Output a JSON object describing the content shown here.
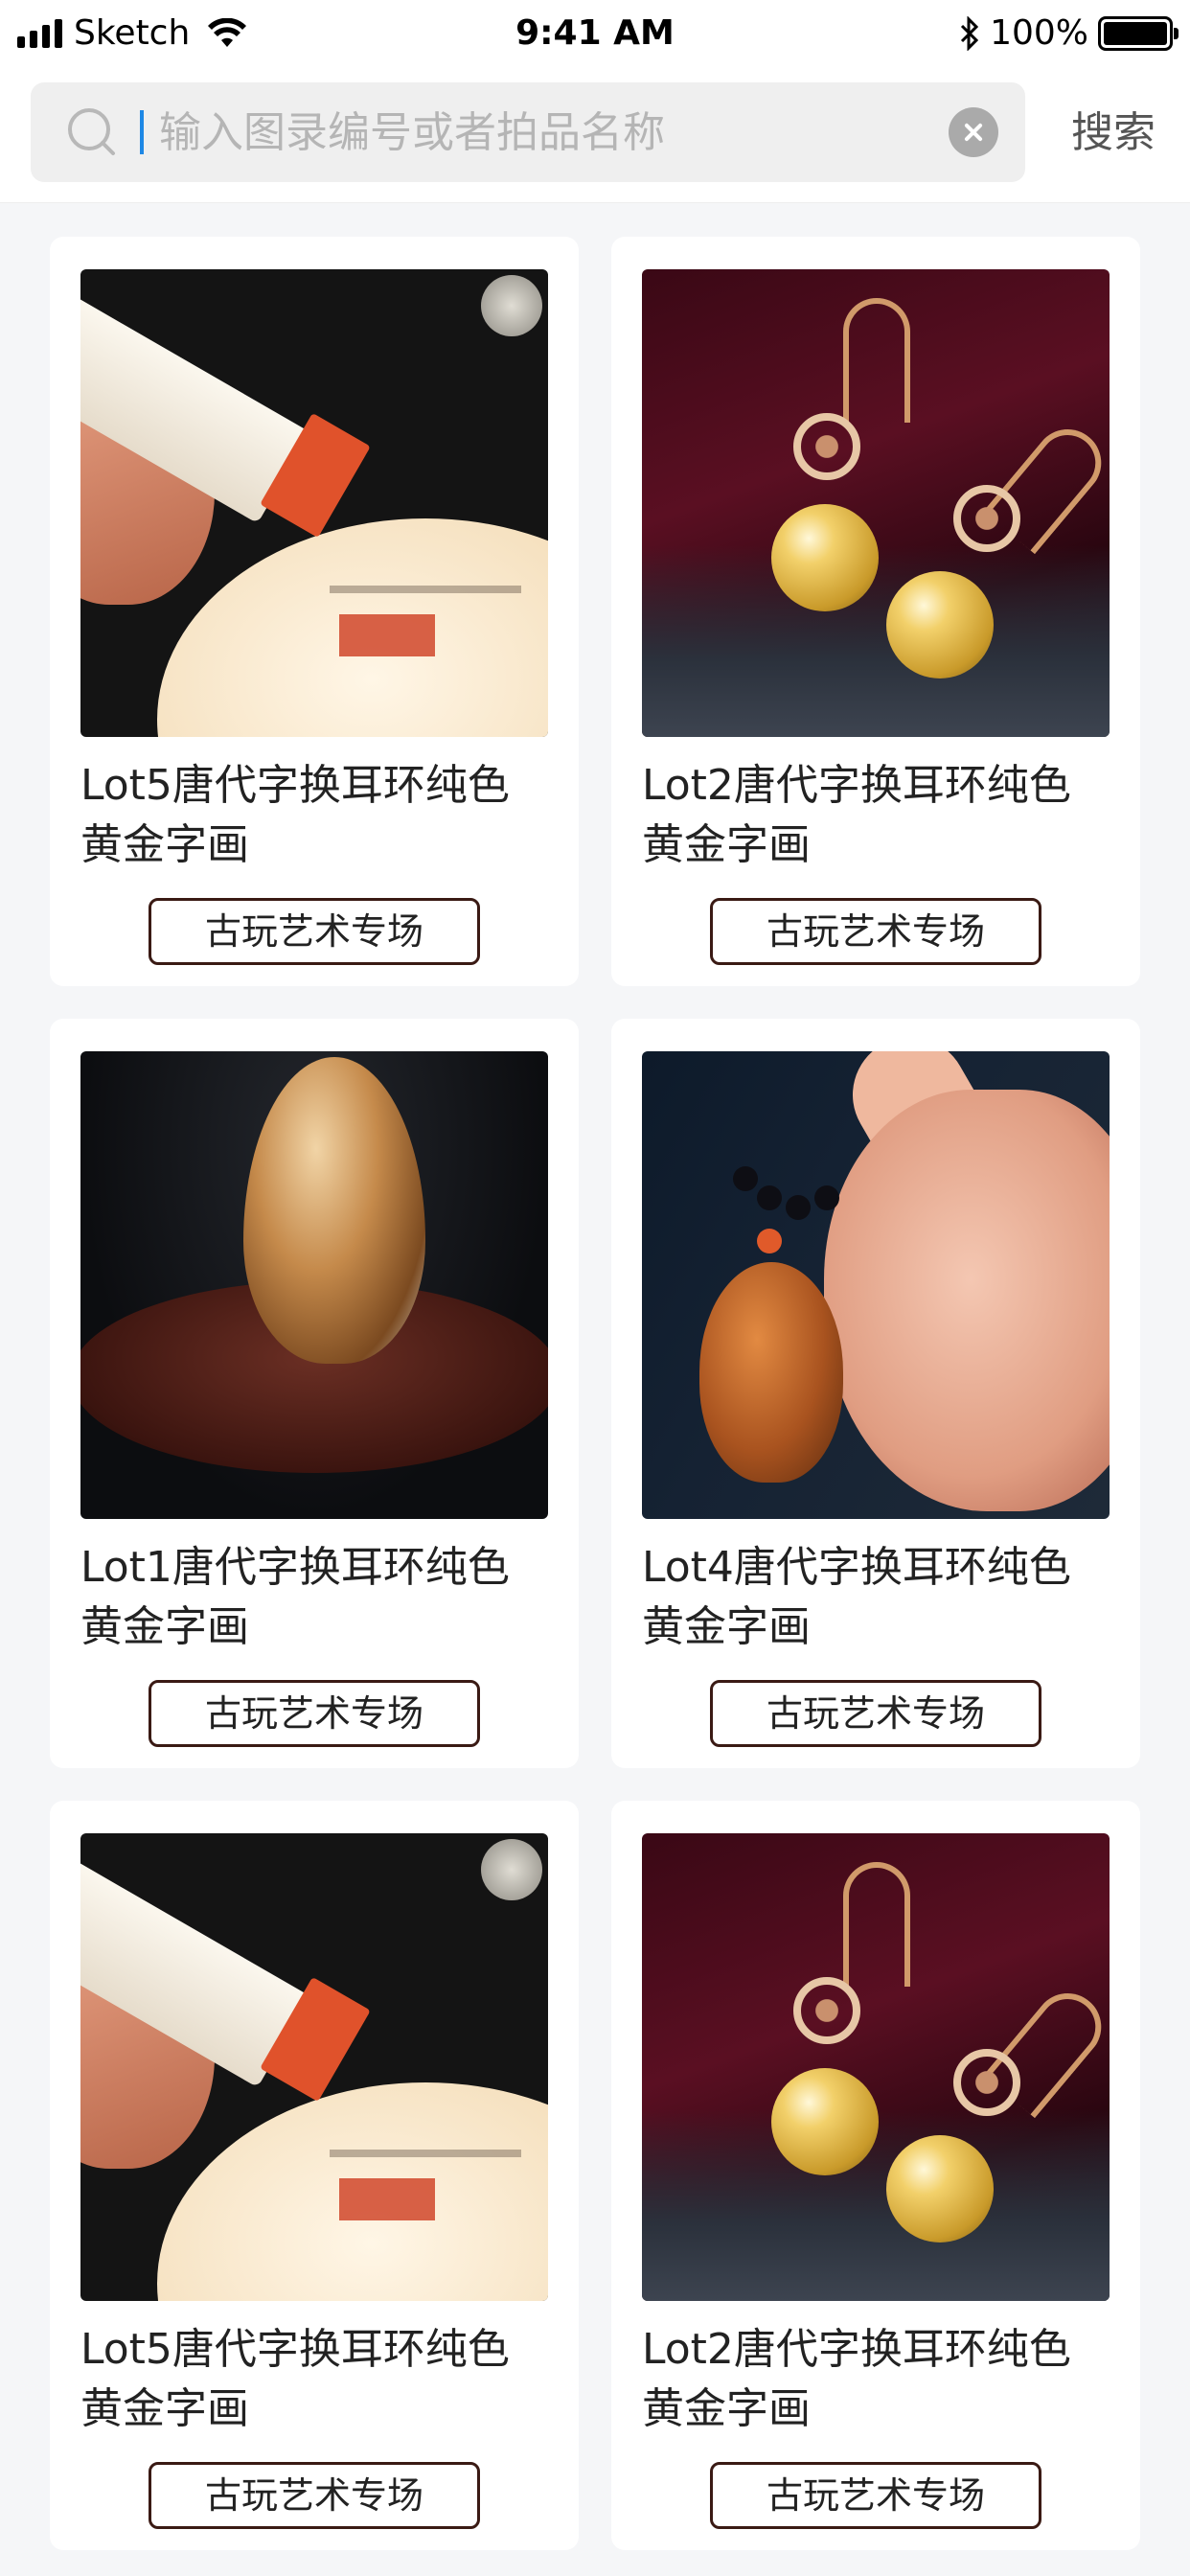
{
  "status_bar": {
    "carrier": "Sketch",
    "time": "9:41 AM",
    "battery": "100%",
    "icons": [
      "signal-icon",
      "wifi-icon",
      "bluetooth-icon",
      "battery-icon"
    ]
  },
  "search": {
    "placeholder": "输入图录编号或者拍品名称",
    "value": "",
    "button_label": "搜索",
    "icons": [
      "search-icon",
      "clear-icon"
    ]
  },
  "items": [
    {
      "title": "Lot5唐代字换耳环纯色黄金字画",
      "tag": "古玩艺术专场",
      "image": "seal"
    },
    {
      "title": "Lot2唐代字换耳环纯色黄金字画",
      "tag": "古玩艺术专场",
      "image": "pearl"
    },
    {
      "title": "Lot1唐代字换耳环纯色黄金字画",
      "tag": "古玩艺术专场",
      "image": "stone"
    },
    {
      "title": "Lot4唐代字换耳环纯色黄金字画",
      "tag": "古玩艺术专场",
      "image": "hand"
    },
    {
      "title": "Lot5唐代字换耳环纯色黄金字画",
      "tag": "古玩艺术专场",
      "image": "seal"
    },
    {
      "title": "Lot2唐代字换耳环纯色黄金字画",
      "tag": "古玩艺术专场",
      "image": "pearl"
    }
  ],
  "colors": {
    "accent_caret": "#1e88e5",
    "tag_border": "#3a1a14",
    "page_bg": "#f5f6f8"
  }
}
